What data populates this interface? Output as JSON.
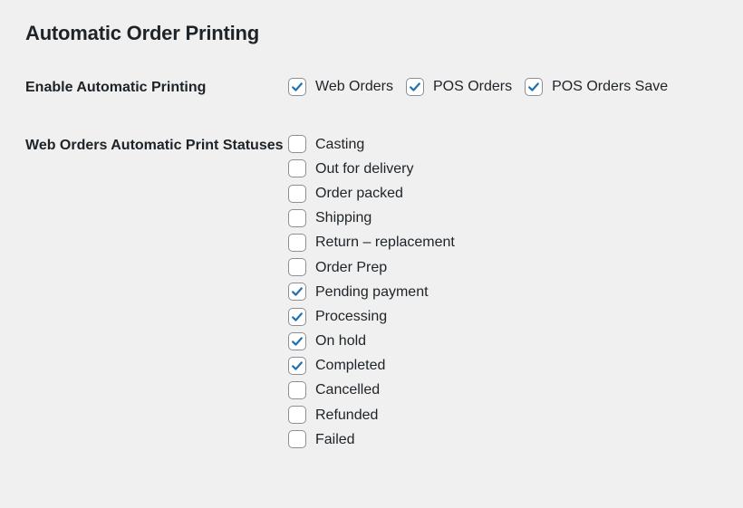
{
  "section": {
    "title": "Automatic Order Printing"
  },
  "fields": {
    "enable": {
      "label": "Enable Automatic Printing",
      "options": [
        {
          "label": "Web Orders",
          "checked": true
        },
        {
          "label": "POS Orders",
          "checked": true
        },
        {
          "label": "POS Orders Save",
          "checked": true
        }
      ]
    },
    "statuses": {
      "label": "Web Orders Automatic Print Statuses",
      "options": [
        {
          "label": "Casting",
          "checked": false
        },
        {
          "label": "Out for delivery",
          "checked": false
        },
        {
          "label": "Order packed",
          "checked": false
        },
        {
          "label": "Shipping",
          "checked": false
        },
        {
          "label": "Return – replacement",
          "checked": false
        },
        {
          "label": "Order Prep",
          "checked": false
        },
        {
          "label": "Pending payment",
          "checked": true
        },
        {
          "label": "Processing",
          "checked": true
        },
        {
          "label": "On hold",
          "checked": true
        },
        {
          "label": "Completed",
          "checked": true
        },
        {
          "label": "Cancelled",
          "checked": false
        },
        {
          "label": "Refunded",
          "checked": false
        },
        {
          "label": "Failed",
          "checked": false
        }
      ]
    }
  },
  "colors": {
    "accent": "#2271b1",
    "border": "#8c8f94",
    "text": "#1d2327",
    "bg": "#f0f0f1"
  }
}
